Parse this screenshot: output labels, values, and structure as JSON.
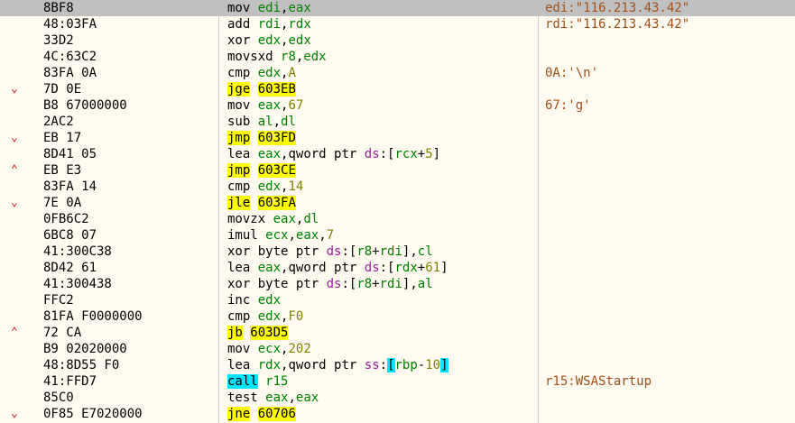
{
  "rows": [
    {
      "arrow": "",
      "bytes": "8BF8",
      "mn": "mov",
      "mn_kind": "plain",
      "operands": [
        {
          "t": "reg",
          "v": "edi"
        },
        {
          "t": "pct",
          "v": ","
        },
        {
          "t": "reg",
          "v": "eax"
        }
      ],
      "comment": "edi:\"116.213.43.42\"",
      "selected": true
    },
    {
      "arrow": "",
      "bytes": "48:03FA",
      "mn": "add",
      "mn_kind": "plain",
      "operands": [
        {
          "t": "reg",
          "v": "rdi"
        },
        {
          "t": "pct",
          "v": ","
        },
        {
          "t": "reg",
          "v": "rdx"
        }
      ],
      "comment": "rdi:\"116.213.43.42\""
    },
    {
      "arrow": "",
      "bytes": "33D2",
      "mn": "xor",
      "mn_kind": "plain",
      "operands": [
        {
          "t": "reg",
          "v": "edx"
        },
        {
          "t": "pct",
          "v": ","
        },
        {
          "t": "reg",
          "v": "edx"
        }
      ],
      "comment": ""
    },
    {
      "arrow": "",
      "bytes": "4C:63C2",
      "mn": "movsxd",
      "mn_kind": "plain",
      "operands": [
        {
          "t": "reg",
          "v": "r8"
        },
        {
          "t": "pct",
          "v": ","
        },
        {
          "t": "reg",
          "v": "edx"
        }
      ],
      "comment": ""
    },
    {
      "arrow": "",
      "bytes": "83FA 0A",
      "mn": "cmp",
      "mn_kind": "plain",
      "operands": [
        {
          "t": "reg",
          "v": "edx"
        },
        {
          "t": "pct",
          "v": ","
        },
        {
          "t": "num",
          "v": "A"
        }
      ],
      "comment": "0A:'\\n'"
    },
    {
      "arrow": "⌄",
      "bytes": "7D 0E",
      "mn": "jge",
      "mn_kind": "jmp",
      "operands": [
        {
          "t": "tgt",
          "v": "603EB"
        }
      ],
      "comment": ""
    },
    {
      "arrow": "",
      "bytes": "B8 67000000",
      "mn": "mov",
      "mn_kind": "plain",
      "operands": [
        {
          "t": "reg",
          "v": "eax"
        },
        {
          "t": "pct",
          "v": ","
        },
        {
          "t": "num",
          "v": "67"
        }
      ],
      "comment": "67:'g'"
    },
    {
      "arrow": "",
      "bytes": "2AC2",
      "mn": "sub",
      "mn_kind": "plain",
      "operands": [
        {
          "t": "reg",
          "v": "al"
        },
        {
          "t": "pct",
          "v": ","
        },
        {
          "t": "reg",
          "v": "dl"
        }
      ],
      "comment": ""
    },
    {
      "arrow": "⌄",
      "bytes": "EB 17",
      "mn": "jmp",
      "mn_kind": "jmp",
      "operands": [
        {
          "t": "tgt",
          "v": "603FD"
        }
      ],
      "comment": ""
    },
    {
      "arrow": "",
      "bytes": "8D41 05",
      "mn": "lea",
      "mn_kind": "plain",
      "operands": [
        {
          "t": "reg",
          "v": "eax"
        },
        {
          "t": "pct",
          "v": ","
        },
        {
          "t": "ptr",
          "v": "qword ptr "
        },
        {
          "t": "seg",
          "v": "ds"
        },
        {
          "t": "pct",
          "v": ":["
        },
        {
          "t": "reg",
          "v": "rcx"
        },
        {
          "t": "pct",
          "v": "+"
        },
        {
          "t": "num",
          "v": "5"
        },
        {
          "t": "pct",
          "v": "]"
        }
      ],
      "comment": ""
    },
    {
      "arrow": "⌃",
      "bytes": "EB E3",
      "mn": "jmp",
      "mn_kind": "jmp",
      "operands": [
        {
          "t": "tgt",
          "v": "603CE"
        }
      ],
      "comment": ""
    },
    {
      "arrow": "",
      "bytes": "83FA 14",
      "mn": "cmp",
      "mn_kind": "plain",
      "operands": [
        {
          "t": "reg",
          "v": "edx"
        },
        {
          "t": "pct",
          "v": ","
        },
        {
          "t": "num",
          "v": "14"
        }
      ],
      "comment": ""
    },
    {
      "arrow": "⌄",
      "bytes": "7E 0A",
      "mn": "jle",
      "mn_kind": "jmp",
      "operands": [
        {
          "t": "tgt",
          "v": "603FA"
        }
      ],
      "comment": ""
    },
    {
      "arrow": "",
      "bytes": "0FB6C2",
      "mn": "movzx",
      "mn_kind": "plain",
      "operands": [
        {
          "t": "reg",
          "v": "eax"
        },
        {
          "t": "pct",
          "v": ","
        },
        {
          "t": "reg",
          "v": "dl"
        }
      ],
      "comment": ""
    },
    {
      "arrow": "",
      "bytes": "6BC8 07",
      "mn": "imul",
      "mn_kind": "plain",
      "operands": [
        {
          "t": "reg",
          "v": "ecx"
        },
        {
          "t": "pct",
          "v": ","
        },
        {
          "t": "reg",
          "v": "eax"
        },
        {
          "t": "pct",
          "v": ","
        },
        {
          "t": "num",
          "v": "7"
        }
      ],
      "comment": ""
    },
    {
      "arrow": "",
      "bytes": "41:300C38",
      "mn": "xor",
      "mn_kind": "plain",
      "operands": [
        {
          "t": "ptr",
          "v": "byte ptr "
        },
        {
          "t": "seg",
          "v": "ds"
        },
        {
          "t": "pct",
          "v": ":["
        },
        {
          "t": "reg",
          "v": "r8"
        },
        {
          "t": "pct",
          "v": "+"
        },
        {
          "t": "reg",
          "v": "rdi"
        },
        {
          "t": "pct",
          "v": "],"
        },
        {
          "t": "reg",
          "v": "cl"
        }
      ],
      "comment": ""
    },
    {
      "arrow": "",
      "bytes": "8D42 61",
      "mn": "lea",
      "mn_kind": "plain",
      "operands": [
        {
          "t": "reg",
          "v": "eax"
        },
        {
          "t": "pct",
          "v": ","
        },
        {
          "t": "ptr",
          "v": "qword ptr "
        },
        {
          "t": "seg",
          "v": "ds"
        },
        {
          "t": "pct",
          "v": ":["
        },
        {
          "t": "reg",
          "v": "rdx"
        },
        {
          "t": "pct",
          "v": "+"
        },
        {
          "t": "num",
          "v": "61"
        },
        {
          "t": "pct",
          "v": "]"
        }
      ],
      "comment": ""
    },
    {
      "arrow": "",
      "bytes": "41:300438",
      "mn": "xor",
      "mn_kind": "plain",
      "operands": [
        {
          "t": "ptr",
          "v": "byte ptr "
        },
        {
          "t": "seg",
          "v": "ds"
        },
        {
          "t": "pct",
          "v": ":["
        },
        {
          "t": "reg",
          "v": "r8"
        },
        {
          "t": "pct",
          "v": "+"
        },
        {
          "t": "reg",
          "v": "rdi"
        },
        {
          "t": "pct",
          "v": "],"
        },
        {
          "t": "reg",
          "v": "al"
        }
      ],
      "comment": ""
    },
    {
      "arrow": "",
      "bytes": "FFC2",
      "mn": "inc",
      "mn_kind": "plain",
      "operands": [
        {
          "t": "reg",
          "v": "edx"
        }
      ],
      "comment": ""
    },
    {
      "arrow": "",
      "bytes": "81FA F0000000",
      "mn": "cmp",
      "mn_kind": "plain",
      "operands": [
        {
          "t": "reg",
          "v": "edx"
        },
        {
          "t": "pct",
          "v": ","
        },
        {
          "t": "num",
          "v": "F0"
        }
      ],
      "comment": ""
    },
    {
      "arrow": "⌃",
      "bytes": "72 CA",
      "mn": "jb",
      "mn_kind": "jmp",
      "operands": [
        {
          "t": "tgt",
          "v": "603D5"
        }
      ],
      "comment": ""
    },
    {
      "arrow": "",
      "bytes": "B9 02020000",
      "mn": "mov",
      "mn_kind": "plain",
      "operands": [
        {
          "t": "reg",
          "v": "ecx"
        },
        {
          "t": "pct",
          "v": ","
        },
        {
          "t": "num",
          "v": "202"
        }
      ],
      "comment": ""
    },
    {
      "arrow": "",
      "bytes": "48:8D55 F0",
      "mn": "lea",
      "mn_kind": "plain",
      "operands": [
        {
          "t": "reg",
          "v": "rdx"
        },
        {
          "t": "pct",
          "v": ","
        },
        {
          "t": "ptr",
          "v": "qword ptr "
        },
        {
          "t": "seg",
          "v": "ss"
        },
        {
          "t": "pct",
          "v": ":"
        },
        {
          "t": "brkhl",
          "v": "["
        },
        {
          "t": "reg",
          "v": "rbp"
        },
        {
          "t": "pct",
          "v": "-"
        },
        {
          "t": "num",
          "v": "10"
        },
        {
          "t": "brkhl",
          "v": "]"
        }
      ],
      "comment": ""
    },
    {
      "arrow": "",
      "bytes": "41:FFD7",
      "mn": "call",
      "mn_kind": "call",
      "operands": [
        {
          "t": "reg",
          "v": "r15"
        }
      ],
      "comment": "r15:WSAStartup"
    },
    {
      "arrow": "",
      "bytes": "85C0",
      "mn": "test",
      "mn_kind": "plain",
      "operands": [
        {
          "t": "reg",
          "v": "eax"
        },
        {
          "t": "pct",
          "v": ","
        },
        {
          "t": "reg",
          "v": "eax"
        }
      ],
      "comment": ""
    },
    {
      "arrow": "⌄",
      "bytes": "0F85 E7020000",
      "mn": "jne",
      "mn_kind": "jmp",
      "operands": [
        {
          "t": "tgt",
          "v": "60706"
        }
      ],
      "comment": ""
    }
  ]
}
